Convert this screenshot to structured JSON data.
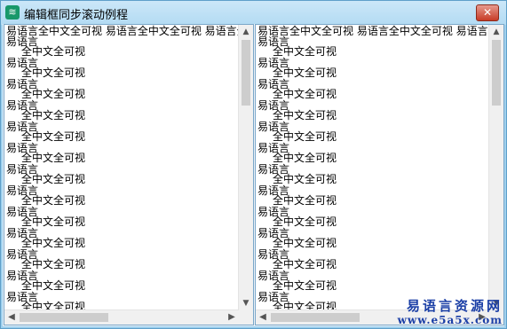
{
  "window": {
    "title": "编辑框同步滚动例程",
    "close_label": "✕",
    "icon": "app-icon"
  },
  "editbox_left": {
    "first_line": "易语言全中文全可视  易语言全中文全可视  易语言全中文全可视",
    "lines": [
      {
        "a": "易语言",
        "b": "全中文全可视"
      },
      {
        "a": "易语言",
        "b": "全中文全可视"
      },
      {
        "a": "易语言",
        "b": "全中文全可视"
      },
      {
        "a": "易语言",
        "b": "全中文全可视"
      },
      {
        "a": "易语言",
        "b": "全中文全可视"
      },
      {
        "a": "易语言",
        "b": "全中文全可视"
      },
      {
        "a": "易语言",
        "b": "全中文全可视"
      },
      {
        "a": "易语言",
        "b": "全中文全可视"
      },
      {
        "a": "易语言",
        "b": "全中文全可视"
      },
      {
        "a": "易语言",
        "b": "全中文全可视"
      },
      {
        "a": "易语言",
        "b": "全中文全可视"
      },
      {
        "a": "易语言",
        "b": "全中文全可视"
      },
      {
        "a": "易语言",
        "b": "全中文全可视"
      }
    ]
  },
  "editbox_right": {
    "first_line": "易语言全中文全可视  易语言全中文全可视  易语言全中文全可视",
    "lines": [
      {
        "a": "易语言",
        "b": "全中文全可视"
      },
      {
        "a": "易语言",
        "b": "全中文全可视"
      },
      {
        "a": "易语言",
        "b": "全中文全可视"
      },
      {
        "a": "易语言",
        "b": "全中文全可视"
      },
      {
        "a": "易语言",
        "b": "全中文全可视"
      },
      {
        "a": "易语言",
        "b": "全中文全可视"
      },
      {
        "a": "易语言",
        "b": "全中文全可视"
      },
      {
        "a": "易语言",
        "b": "全中文全可视"
      },
      {
        "a": "易语言",
        "b": "全中文全可视"
      },
      {
        "a": "易语言",
        "b": "全中文全可视"
      },
      {
        "a": "易语言",
        "b": "全中文全可视"
      },
      {
        "a": "易语言",
        "b": "全中文全可视"
      },
      {
        "a": "易语言",
        "b": "全中文全可视"
      }
    ]
  },
  "watermark": {
    "line1": "易语言资源网",
    "line2": "www.e5a5x.com"
  }
}
